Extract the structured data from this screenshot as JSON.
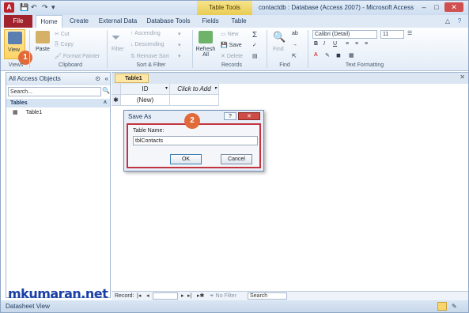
{
  "titlebar": {
    "app_icon": "A",
    "context_tab": "Table Tools",
    "title": "contactdb : Database (Access 2007) - Microsoft Access",
    "minimize": "–",
    "maximize": "□",
    "close": "✕"
  },
  "tabs": {
    "file": "File",
    "home": "Home",
    "create": "Create",
    "external": "External Data",
    "dbtools": "Database Tools",
    "fields": "Fields",
    "table": "Table"
  },
  "ribbon": {
    "view": "View",
    "views_group": "Views",
    "paste": "Paste",
    "cut": "Cut",
    "copy": "Copy",
    "format_painter": "Format Painter",
    "clipboard_group": "Clipboard",
    "filter": "Filter",
    "ascending": "Ascending",
    "descending": "Descending",
    "remove_sort": "Remove Sort",
    "sort_group": "Sort & Filter",
    "refresh": "Refresh All",
    "new": "New",
    "save": "Save",
    "delete": "Delete",
    "records_group": "Records",
    "find": "Find",
    "find_group": "Find",
    "font_name": "Calibri (Detail)",
    "font_size": "11",
    "text_group": "Text Formatting"
  },
  "nav": {
    "header": "All Access Objects",
    "search_placeholder": "Search...",
    "group": "Tables",
    "item": "Table1"
  },
  "document": {
    "tab": "Table1",
    "col_id": "ID",
    "col_add": "Click to Add",
    "new_row": "(New)",
    "new_marker": "✱"
  },
  "dialog": {
    "title": "Save As",
    "help": "?",
    "close": "✕",
    "label": "Table Name:",
    "value": "tblContacts",
    "ok": "OK",
    "cancel": "Cancel"
  },
  "callouts": {
    "one": "1",
    "two": "2"
  },
  "record_nav": {
    "label": "Record:",
    "no_filter": "No Filter",
    "search": "Search"
  },
  "status": {
    "text": "Datasheet View"
  },
  "watermark": "mkumaran.net"
}
